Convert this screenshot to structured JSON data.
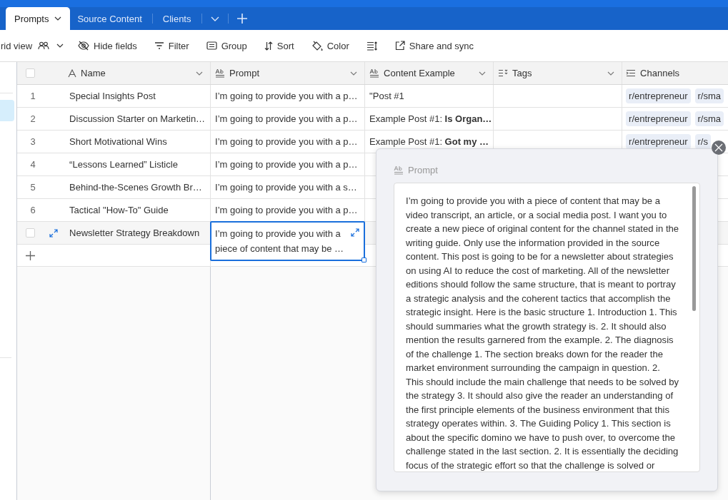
{
  "tabs": [
    {
      "label": "Prompts",
      "selected": true
    },
    {
      "label": "Source Content",
      "selected": false
    },
    {
      "label": "Clients",
      "selected": false
    }
  ],
  "toolbar": {
    "view_name": "rid view",
    "buttons": [
      {
        "kind": "hide",
        "label": "Hide fields"
      },
      {
        "kind": "filter",
        "label": "Filter"
      },
      {
        "kind": "group",
        "label": "Group"
      },
      {
        "kind": "sort",
        "label": "Sort"
      },
      {
        "kind": "color",
        "label": "Color"
      },
      {
        "kind": "row-height"
      },
      {
        "kind": "share",
        "label": "Share and sync"
      }
    ]
  },
  "table": {
    "columns": [
      {
        "label": "Name",
        "kind": "text",
        "dropdown": true
      },
      {
        "label": "Prompt",
        "kind": "longtext",
        "dropdown": true
      },
      {
        "label": "Content Example",
        "kind": "longtext",
        "dropdown": true
      },
      {
        "label": "Tags",
        "kind": "multiselect",
        "dropdown": true
      },
      {
        "label": "Channels",
        "kind": "links",
        "dropdown": false
      }
    ],
    "all_selected": false,
    "rows": [
      {
        "number": "1",
        "hovered": false,
        "checked": false,
        "name": "Special Insights Post",
        "prompt": "I’m going to provide you with a p…",
        "prompt_selected": false,
        "content_example": "\"Post #1",
        "channels": [
          "r/entrepreneur",
          "r/sma"
        ]
      },
      {
        "number": "2",
        "hovered": false,
        "checked": false,
        "name": "Discussion Starter on Marketin…",
        "prompt": "I’m going to provide you with a p…",
        "prompt_selected": false,
        "content_example": "Example Post #1: **Is Organ…**",
        "channels": [
          "r/entrepreneur",
          "r/sma"
        ]
      },
      {
        "number": "3",
        "hovered": false,
        "checked": false,
        "name": "Short Motivational Wins",
        "prompt": "I’m going to provide you with a p…",
        "prompt_selected": false,
        "content_example": "Example Post #1: **Got my …**",
        "channels": [
          "r/entrepreneur",
          "r/s"
        ]
      },
      {
        "number": "4",
        "hovered": false,
        "checked": false,
        "name": "“Lessons Learned” Listicle",
        "prompt": "I’m going to provide you with a p…",
        "prompt_selected": false
      },
      {
        "number": "5",
        "hovered": false,
        "checked": false,
        "name": "Behind-the-Scenes Growth Br…",
        "prompt": "I’m going to provide you with a s…",
        "prompt_selected": false
      },
      {
        "number": "6",
        "hovered": false,
        "checked": false,
        "name": "Tactical \"How-To\" Guide",
        "prompt": "I’m going to provide you with a p…",
        "prompt_selected": false
      },
      {
        "hovered": true,
        "checked": false,
        "name": "Newsletter Strategy Breakdown",
        "prompt": "I’m going to provide you with a piece of content that may be …",
        "prompt_selected": true
      }
    ]
  },
  "expanded_field": {
    "label": "Prompt",
    "text": "I’m going to provide you with a piece of content that may be a video transcript, an article, or a social media post. I want you to create a new piece of original content for the channel stated in the writing guide. Only use the information provided in the source content. This post is going to be for a newsletter about strategies on using AI to reduce the cost of marketing. All of the newsletter editions should follow the same structure, that is meant to portray a strategic analysis and the coherent tactics that accomplish the strategic insight. Here is the basic structure 1. Introduction 1. This should summaries what the growth strategy is. 2. It should also mention the results garnered from the example. 2. The diagnosis of the challenge 1. The section breaks down for the reader the market environment surrounding the campaign in question. 2. This should include the main challenge that needs to be solved by the strategy 3. It should also give the reader an understanding of the first principle elements of the business environment that this strategy operates within. 3. The Guiding Policy 1. This section is about the specific domino we have to push over, to overcome the challenge stated in the last section. 2. It is essentially the deciding focus of the strategic effort so that the challenge is solved or"
  }
}
